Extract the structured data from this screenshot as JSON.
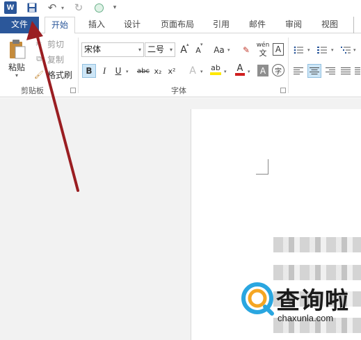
{
  "qat": {
    "app_icon": "W",
    "icons": [
      "word-app-icon",
      "save-icon",
      "undo-icon",
      "redo-icon",
      "touch-mode-icon",
      "customize-qat-icon"
    ]
  },
  "tabs": [
    {
      "label": "文件"
    },
    {
      "label": "开始"
    },
    {
      "label": "插入"
    },
    {
      "label": "设计"
    },
    {
      "label": "页面布局"
    },
    {
      "label": "引用"
    },
    {
      "label": "邮件"
    },
    {
      "label": "审阅"
    },
    {
      "label": "视图"
    }
  ],
  "clipboard": {
    "paste_label": "粘贴",
    "cut_label": "剪切",
    "copy_label": "复制",
    "format_painter_label": "格式刷",
    "group_label": "剪贴板"
  },
  "font": {
    "font_name": "宋体",
    "font_size": "二号",
    "grow": "A",
    "shrink": "A",
    "change_case": "Aa",
    "phonetic_top": "wén",
    "phonetic_bottom": "文",
    "char_border": "A",
    "bold": "B",
    "italic": "I",
    "underline": "U",
    "strike": "abc",
    "subscript": "x₂",
    "superscript": "x²",
    "text_effect": "A",
    "highlight": "ab",
    "font_color": "A",
    "char_shading": "A",
    "enclose": "字",
    "group_label": "字体"
  },
  "watermark": {
    "title": "查询啦",
    "subtitle": "chaxunla.com"
  },
  "colors": {
    "accent": "#2b579a",
    "annotation_arrow": "#9a1e22",
    "font_color_bar": "#d01f1f",
    "highlight_bar": "#ffe800"
  }
}
